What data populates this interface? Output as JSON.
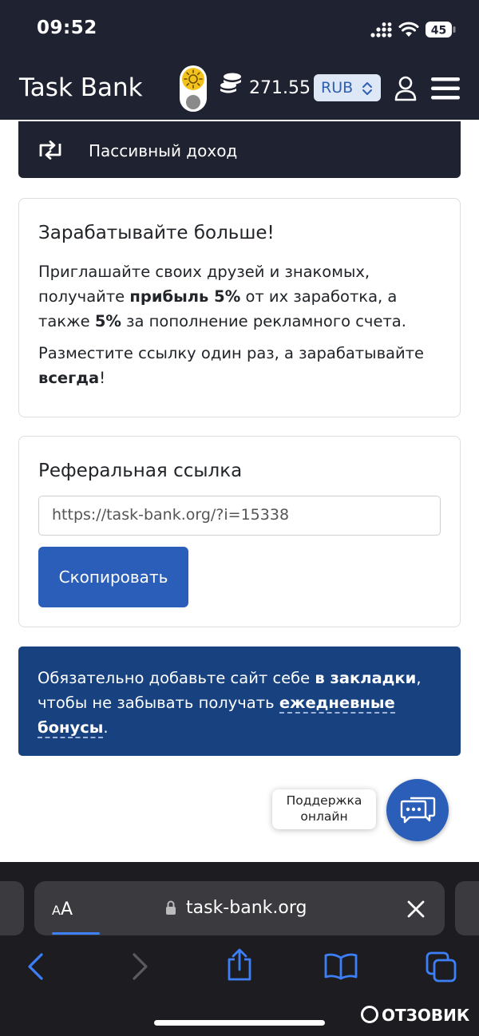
{
  "status_bar": {
    "time": "09:52",
    "battery": "45"
  },
  "header": {
    "brand": "Task Bank",
    "balance": "271.55",
    "currency": "RUB"
  },
  "passive_income": {
    "label": "Пассивный доход"
  },
  "earn_card": {
    "title": "Зарабатывайте больше!",
    "p1_a": "Приглашайте своих друзей и знакомых, получайте ",
    "p1_b": "прибыль 5%",
    "p1_c": " от их заработка, а также ",
    "p1_d": "5%",
    "p1_e": " за пополнение рекламного счета.",
    "p2_a": "Разместите ссылку один раз, а зарабатывайте ",
    "p2_b": "всегда",
    "p2_c": "!"
  },
  "referral_card": {
    "title": "Реферальная ссылка",
    "link": "https://task-bank.org/?i=15338",
    "copy_label": "Скопировать"
  },
  "alert": {
    "a": "Обязательно добавьте сайт себе ",
    "b": "в закладки",
    "c": ", чтобы не забывать получать ",
    "d": "ежедневные бонусы",
    "e": "."
  },
  "support": {
    "tooltip_line1": "Поддержка",
    "tooltip_line2": "онлайн"
  },
  "safari": {
    "aa_small": "A",
    "aa_large": "A",
    "url": "task-bank.org"
  },
  "watermark": "ОТЗОВИК",
  "colors": {
    "header_bg": "#1f2230",
    "accent": "#2b5eb8",
    "alert_bg": "#17417f"
  }
}
